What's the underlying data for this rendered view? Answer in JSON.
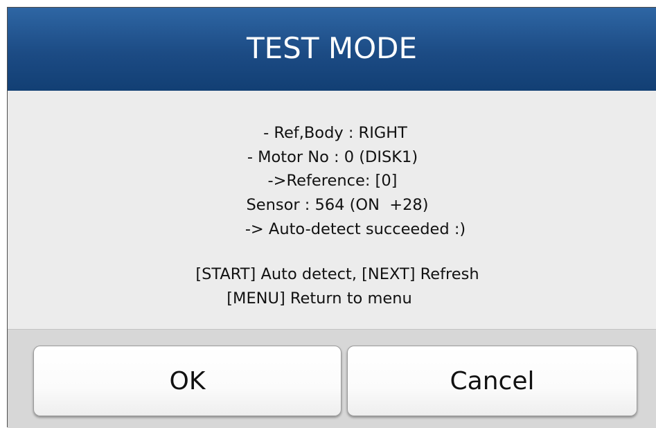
{
  "dialog": {
    "title": "TEST MODE",
    "message_lines": [
      "- Ref,Body : RIGHT",
      "- Motor No : 0 (DISK1)",
      "->Reference: [0]",
      "Sensor : 564 (ON  +28)",
      "-> Auto-detect succeeded :)",
      "[START] Auto detect, [NEXT] Refresh",
      "[MENU] Return to menu"
    ],
    "ok_label": "OK",
    "cancel_label": "Cancel"
  },
  "colors": {
    "title_bar": "#1c4b84",
    "body_background": "#ececec",
    "button_bar": "#d7d7d7",
    "button_face": "#ffffff"
  }
}
